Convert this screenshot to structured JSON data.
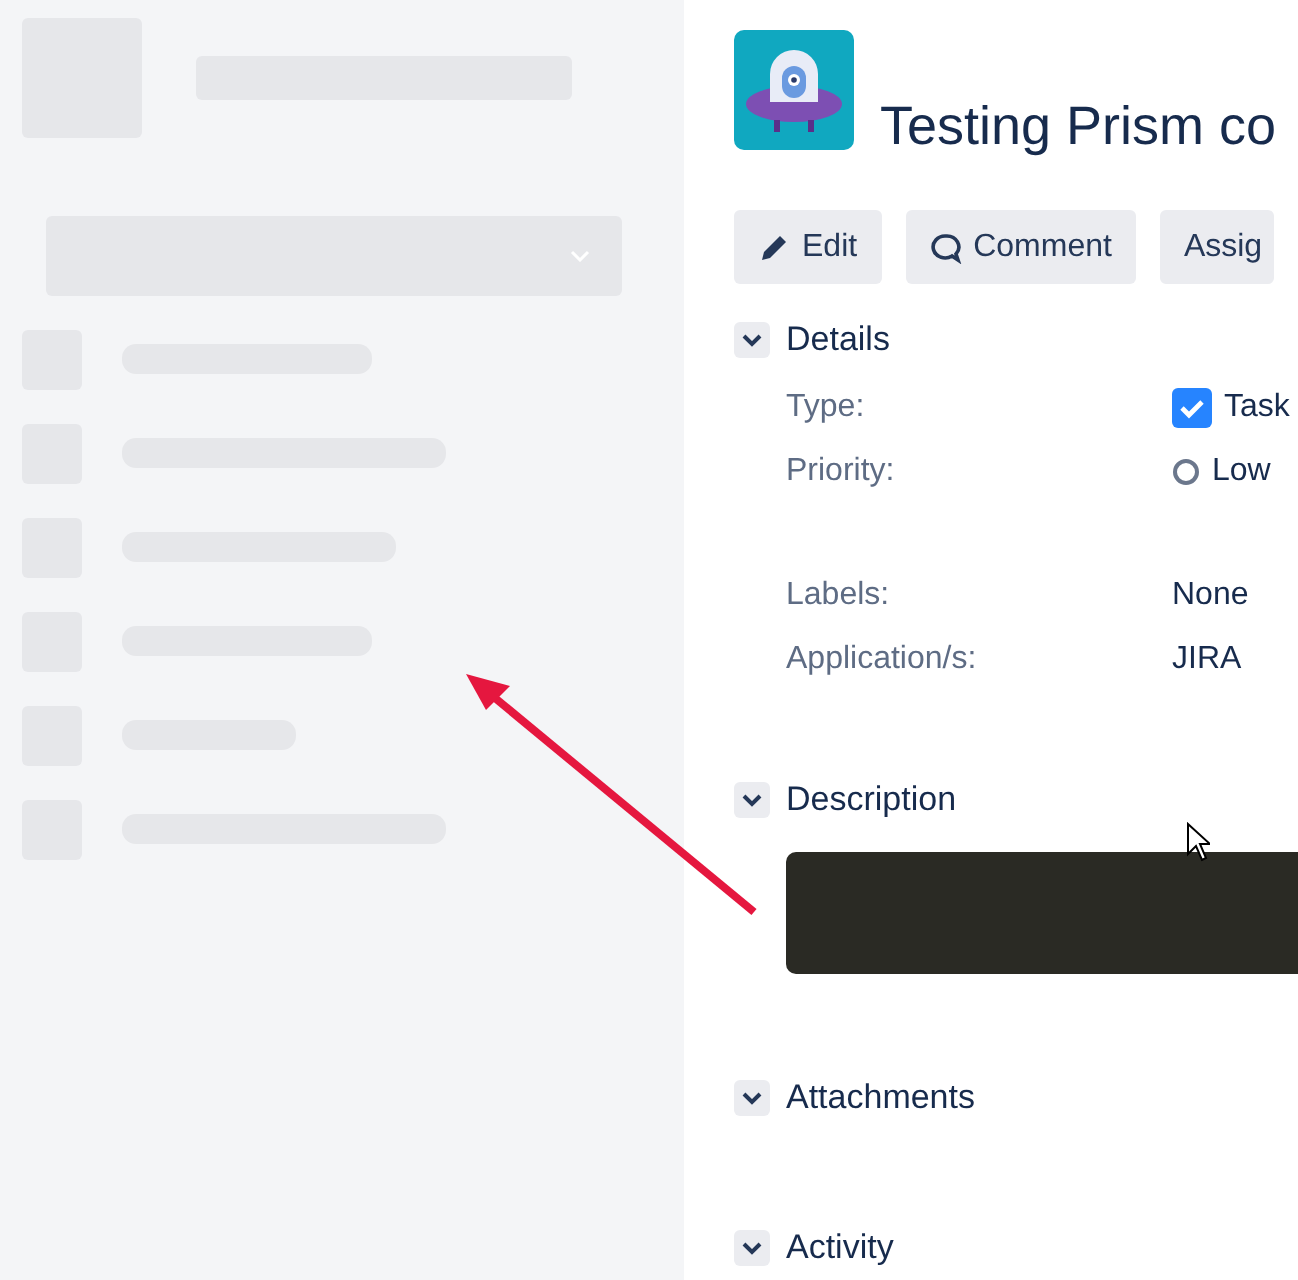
{
  "issue": {
    "title": "Testing Prism co"
  },
  "buttons": [
    {
      "label": "Edit",
      "kind": "edit"
    },
    {
      "label": "Comment",
      "kind": "comment"
    },
    {
      "label": "Assig",
      "kind": "plain"
    }
  ],
  "sections": [
    {
      "title": "Details",
      "expanded": true,
      "kind": "details"
    },
    {
      "title": "Description",
      "expanded": true,
      "kind": "description"
    },
    {
      "title": "Attachments",
      "expanded": true,
      "kind": "empty"
    },
    {
      "title": "Activity",
      "expanded": true,
      "kind": "empty"
    }
  ],
  "field_groups": [
    [
      {
        "label": "Type:",
        "value": "Task",
        "kind": "checkbox"
      },
      {
        "label": "Priority:",
        "value": "Low",
        "kind": "radio"
      }
    ],
    [
      {
        "label": "Labels:",
        "value": "None",
        "kind": "text"
      },
      {
        "label": "Application/s:",
        "value": "JIRA",
        "kind": "text"
      }
    ]
  ]
}
